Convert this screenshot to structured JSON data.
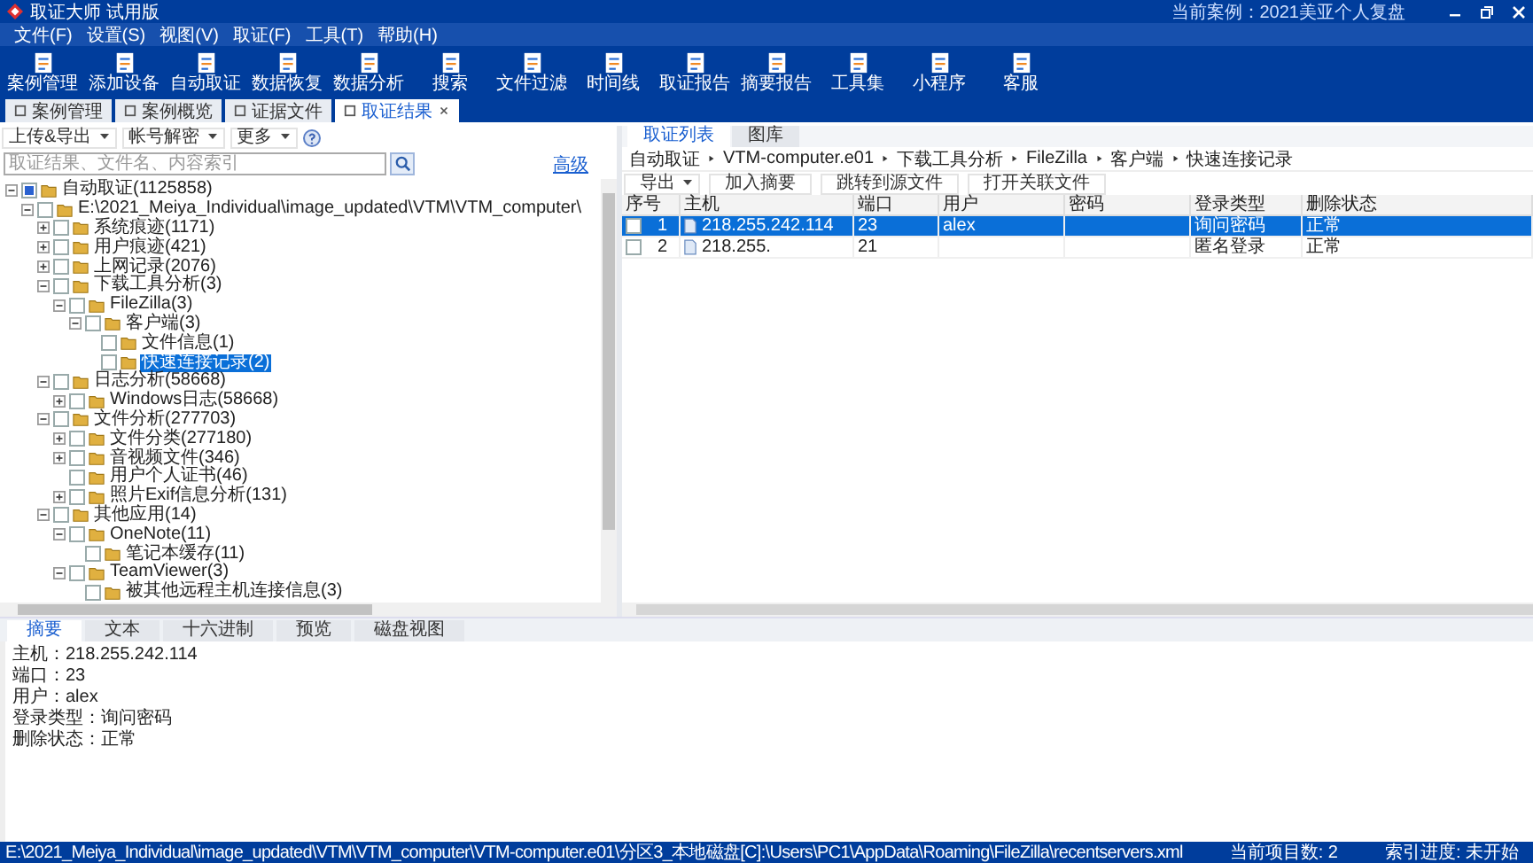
{
  "window": {
    "title": "取证大师 试用版",
    "current_case": "当前案例：2021美亚个人复盘"
  },
  "menu": [
    "文件(F)",
    "设置(S)",
    "视图(V)",
    "取证(F)",
    "工具(T)",
    "帮助(H)"
  ],
  "toolbar": [
    "案例管理",
    "添加设备",
    "自动取证",
    "数据恢复",
    "数据分析",
    "搜索",
    "文件过滤",
    "时间线",
    "取证报告",
    "摘要报告",
    "工具集",
    "小程序",
    "客服"
  ],
  "tabs": [
    {
      "label": "案例管理",
      "selected": false
    },
    {
      "label": "案例概览",
      "selected": false
    },
    {
      "label": "证据文件",
      "selected": false
    },
    {
      "label": "取证结果",
      "selected": true
    }
  ],
  "left": {
    "actions": [
      "上传&导出",
      "帐号解密",
      "更多"
    ],
    "search": {
      "placeholder": "取证结果、文件名、内容索引"
    },
    "advanced_link": "高级",
    "tree": [
      {
        "label": "自动取证(1125858)",
        "expanded": true,
        "checked": true,
        "selected": false,
        "children": [
          {
            "label": "E:\\2021_Meiya_Individual\\image_updated\\VTM\\VTM_computer\\",
            "expanded": true,
            "checked": false,
            "selected": false,
            "children": [
              {
                "label": "系统痕迹(1171)",
                "expanded": false,
                "checked": false,
                "selected": false
              },
              {
                "label": "用户痕迹(421)",
                "expanded": false,
                "checked": false,
                "selected": false
              },
              {
                "label": "上网记录(2076)",
                "expanded": false,
                "checked": false,
                "selected": false
              },
              {
                "label": "下载工具分析(3)",
                "expanded": true,
                "checked": false,
                "selected": false,
                "children": [
                  {
                    "label": "FileZilla(3)",
                    "expanded": true,
                    "checked": false,
                    "selected": false,
                    "children": [
                      {
                        "label": "客户端(3)",
                        "expanded": true,
                        "checked": false,
                        "selected": false,
                        "children": [
                          {
                            "label": "文件信息(1)",
                            "checked": false,
                            "selected": false
                          },
                          {
                            "label": "快速连接记录(2)",
                            "checked": false,
                            "selected": true
                          }
                        ]
                      }
                    ]
                  }
                ]
              },
              {
                "label": "日志分析(58668)",
                "expanded": true,
                "checked": false,
                "selected": false,
                "children": [
                  {
                    "label": "Windows日志(58668)",
                    "expanded": false,
                    "checked": false,
                    "selected": false
                  }
                ]
              },
              {
                "label": "文件分析(277703)",
                "expanded": true,
                "checked": false,
                "selected": false,
                "children": [
                  {
                    "label": "文件分类(277180)",
                    "expanded": false,
                    "checked": false,
                    "selected": false
                  },
                  {
                    "label": "音视频文件(346)",
                    "expanded": false,
                    "checked": false,
                    "selected": false
                  },
                  {
                    "label": "用户个人证书(46)",
                    "checked": false,
                    "selected": false
                  },
                  {
                    "label": "照片Exif信息分析(131)",
                    "expanded": false,
                    "checked": false,
                    "selected": false
                  }
                ]
              },
              {
                "label": "其他应用(14)",
                "expanded": true,
                "checked": false,
                "selected": false,
                "children": [
                  {
                    "label": "OneNote(11)",
                    "expanded": true,
                    "checked": false,
                    "selected": false,
                    "children": [
                      {
                        "label": "笔记本缓存(11)",
                        "checked": false,
                        "selected": false
                      }
                    ]
                  },
                  {
                    "label": "TeamViewer(3)",
                    "expanded": true,
                    "checked": false,
                    "selected": false,
                    "children": [
                      {
                        "label": "被其他远程主机连接信息(3)",
                        "checked": false,
                        "selected": false
                      }
                    ]
                  }
                ]
              }
            ]
          }
        ]
      }
    ]
  },
  "right": {
    "tabs": [
      {
        "label": "取证列表",
        "selected": true
      },
      {
        "label": "图库",
        "selected": false
      }
    ],
    "breadcrumb": [
      "自动取证",
      "VTM-computer.e01",
      "下载工具分析",
      "FileZilla",
      "客户端",
      "快速连接记录"
    ],
    "buttons": [
      {
        "label": "导出",
        "kind": "dropdown"
      },
      {
        "label": "加入摘要",
        "kind": "plain"
      },
      {
        "label": "跳转到源文件",
        "kind": "plain"
      },
      {
        "label": "打开关联文件",
        "kind": "plain"
      }
    ],
    "table": {
      "columns": [
        "序号",
        "主机",
        "端口",
        "用户",
        "密码",
        "登录类型",
        "删除状态"
      ],
      "rows": [
        {
          "selected": true,
          "checked": false,
          "cells": [
            "1",
            "218.255.242.114",
            "23",
            "alex",
            "",
            "询问密码",
            "正常"
          ]
        },
        {
          "selected": false,
          "checked": false,
          "cells": [
            "2",
            "218.255.",
            "21",
            "",
            "",
            "匿名登录",
            "正常"
          ]
        }
      ]
    }
  },
  "bottom": {
    "tabs": [
      {
        "label": "摘要",
        "selected": true
      },
      {
        "label": "文本",
        "selected": false
      },
      {
        "label": "十六进制",
        "selected": false
      },
      {
        "label": "预览",
        "selected": false
      },
      {
        "label": "磁盘视图",
        "selected": false
      }
    ],
    "details": [
      "主机：218.255.242.114",
      "端口：23",
      "用户：alex",
      "登录类型：询问密码",
      "删除状态：正常"
    ]
  },
  "status_bar": {
    "path": "E:\\2021_Meiya_Individual\\image_updated\\VTM\\VTM_computer\\VTM-computer.e01\\分区3_本地磁盘[C]:\\Users\\PC1\\AppData\\Roaming\\FileZilla\\recentservers.xml",
    "count": "当前项目数: 2",
    "index": "索引进度: 未开始"
  }
}
